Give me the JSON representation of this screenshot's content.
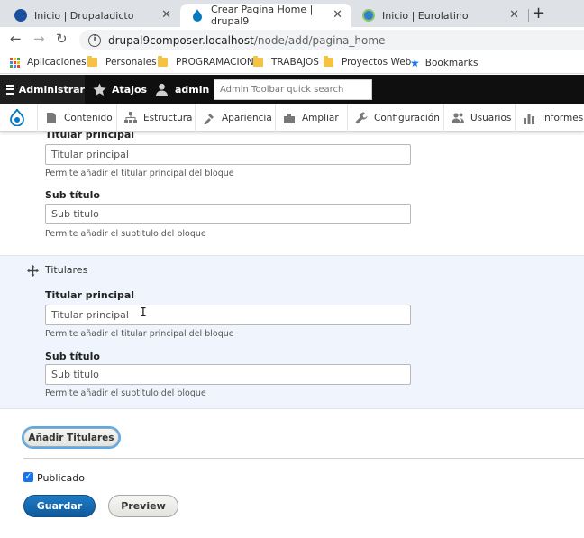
{
  "browser": {
    "tabs": [
      {
        "title": "Inicio | Drupaladicto",
        "active": false,
        "favicon_color": "#1a4fa0"
      },
      {
        "title": "Crear Pagina Home | drupal9",
        "active": true,
        "favicon_color": "#0678be"
      },
      {
        "title": "Inicio | Eurolatino",
        "active": false,
        "favicon_color": "#2f80c8"
      }
    ],
    "close_glyph": "✕",
    "new_tab_glyph": "+",
    "url_host": "drupal9composer.localhost",
    "url_path": "/node/add/pagina_home",
    "bookmarks": [
      {
        "label": "Aplicaciones",
        "icon": "apps-grid-icon"
      },
      {
        "label": "Personales",
        "icon": "folder-icon"
      },
      {
        "label": "PROGRAMACION",
        "icon": "folder-icon"
      },
      {
        "label": "TRABAJOS",
        "icon": "folder-icon"
      },
      {
        "label": "Proyectos Web",
        "icon": "folder-icon"
      },
      {
        "label": "Bookmarks",
        "icon": "star-icon"
      }
    ]
  },
  "toolbar": {
    "manage_label": "Administrar",
    "shortcuts_label": "Atajos",
    "user_label": "admin",
    "search_placeholder": "Admin Toolbar quick search"
  },
  "menu": {
    "items": [
      {
        "label": "Contenido",
        "icon": "content-icon"
      },
      {
        "label": "Estructura",
        "icon": "structure-icon"
      },
      {
        "label": "Apariencia",
        "icon": "appearance-icon"
      },
      {
        "label": "Ampliar",
        "icon": "extend-icon"
      },
      {
        "label": "Configuración",
        "icon": "wrench-icon"
      },
      {
        "label": "Usuarios",
        "icon": "people-icon"
      },
      {
        "label": "Informes",
        "icon": "reports-icon"
      }
    ]
  },
  "form": {
    "rows": [
      {
        "title": "",
        "titular_label": "Titular principal",
        "titular_value": "Titular principal",
        "titular_desc": "Permite añadir el titular principal del bloque",
        "sub_label": "Sub título",
        "sub_value": "Sub titulo",
        "sub_desc": "Permite añadir el subtitulo del bloque"
      },
      {
        "title": "Titulares",
        "titular_label": "Titular principal",
        "titular_value": "Titular principal",
        "titular_desc": "Permite añadir el titular principal del bloque",
        "sub_label": "Sub título",
        "sub_value": "Sub titulo",
        "sub_desc": "Permite añadir el subtitulo del bloque"
      }
    ],
    "add_button": "Añadir Titulares",
    "published_label": "Publicado",
    "published_checked": true,
    "save_button": "Guardar",
    "preview_button": "Preview"
  },
  "colors": {
    "admin_bar": "#0f0f0f",
    "primary_button": "#1565ad",
    "selected_row": "#f0f5fd"
  }
}
